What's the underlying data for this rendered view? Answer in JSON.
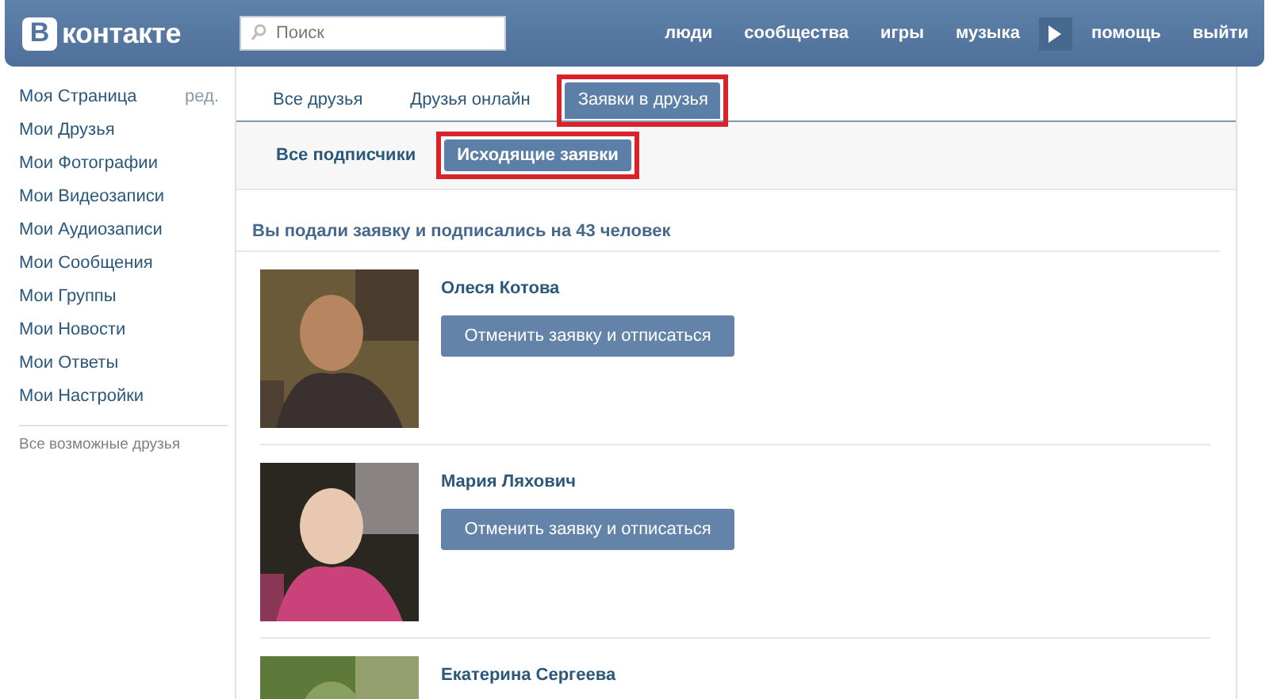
{
  "header": {
    "logo_letter": "В",
    "logo_text": "контакте",
    "search": {
      "placeholder": "Поиск"
    },
    "nav": [
      {
        "label": "люди",
        "kind": "link"
      },
      {
        "label": "сообщества",
        "kind": "link"
      },
      {
        "label": "игры",
        "kind": "link"
      },
      {
        "label": "музыка",
        "kind": "link"
      },
      {
        "kind": "play"
      },
      {
        "label": "помощь",
        "kind": "link"
      },
      {
        "label": "выйти",
        "kind": "link"
      }
    ]
  },
  "sidebar": {
    "items": [
      {
        "label": "Моя Страница",
        "edit": "ред."
      },
      {
        "label": "Мои Друзья"
      },
      {
        "label": "Мои Фотографии"
      },
      {
        "label": "Мои Видеозаписи"
      },
      {
        "label": "Мои Аудиозаписи"
      },
      {
        "label": "Мои Сообщения"
      },
      {
        "label": "Мои Группы"
      },
      {
        "label": "Мои Новости"
      },
      {
        "label": "Мои Ответы"
      },
      {
        "label": "Мои Настройки"
      }
    ],
    "footer_link": "Все возможные друзья"
  },
  "tabs": [
    {
      "label": "Все друзья",
      "selected": false,
      "highlighted": false
    },
    {
      "label": "Друзья онлайн",
      "selected": false,
      "highlighted": false
    },
    {
      "label": "Заявки в друзья",
      "selected": true,
      "highlighted": true
    }
  ],
  "subtabs": [
    {
      "label": "Все подписчики",
      "selected": false,
      "highlighted": false
    },
    {
      "label": "Исходящие заявки",
      "selected": true,
      "highlighted": true
    }
  ],
  "summary": "Вы подали заявку и подписались на 43 человек",
  "requests": [
    {
      "name": "Олеся Котова",
      "button": "Отменить заявку и отписаться"
    },
    {
      "name": "Мария Ляхович",
      "button": "Отменить заявку и отписаться"
    },
    {
      "name": "Екатерина Сергеева"
    }
  ]
}
